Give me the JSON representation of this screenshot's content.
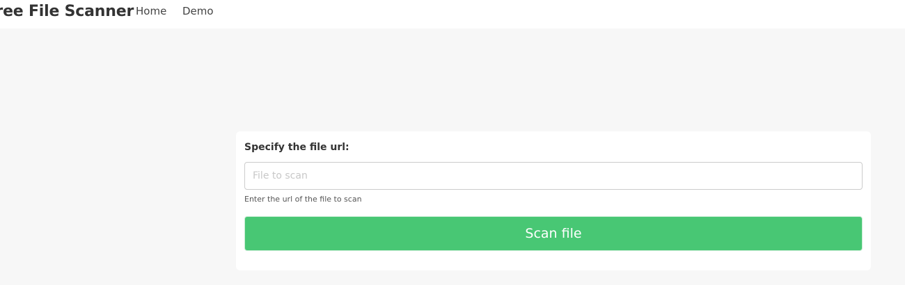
{
  "navbar": {
    "brand": "Free File Scanner",
    "links": [
      {
        "label": "Home"
      },
      {
        "label": "Demo"
      }
    ]
  },
  "form": {
    "label": "Specify the file url:",
    "input_value": "",
    "input_placeholder": "File to scan",
    "help_text": "Enter the url of the file to scan",
    "submit_label": "Scan file"
  },
  "colors": {
    "primary_button": "#48c774",
    "page_background": "#f7f7f7",
    "card_background": "#ffffff"
  }
}
